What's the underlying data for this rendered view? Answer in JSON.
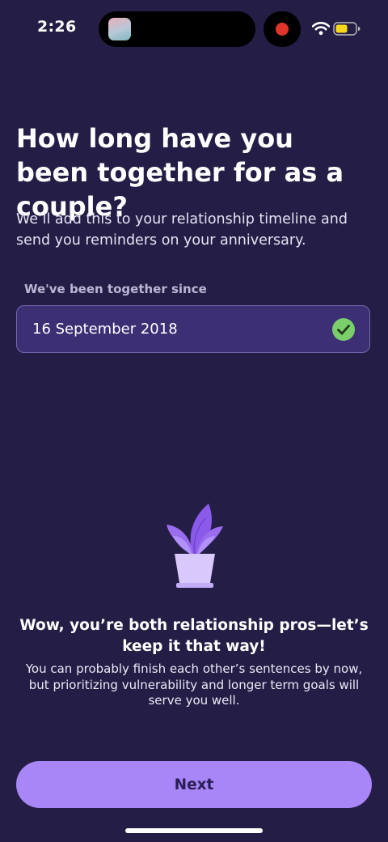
{
  "status_bar": {
    "time": "2:26",
    "icons": [
      "app-thumbnail-icon",
      "recording-dot-icon",
      "wifi-icon",
      "battery-icon"
    ],
    "colors": {
      "recording": "#e0342a",
      "battery": "#f5d81c"
    }
  },
  "question": {
    "title": "How long have you been together for as a couple?",
    "subtitle": "We’ll add this to your relationship timeline and send you reminders on your anniversary."
  },
  "date_field": {
    "label": "We've been together since",
    "value": "16 September 2018",
    "valid_icon": "check-circle-icon",
    "colors": {
      "check": "#7bcf6b"
    }
  },
  "feedback": {
    "icon": "potted-plant-icon",
    "heading": "Wow, you’re both relationship pros—let’s keep it that way!",
    "body": "You can probably finish each other’s sentences by now, but prioritizing vulnerability and longer term goals will serve you well."
  },
  "actions": {
    "next_label": "Next"
  },
  "colors": {
    "background": "#241d45",
    "accent": "#a886f7",
    "field_background": "#3d2f74",
    "plant_leaves": "#9a6cf0",
    "plant_pot": "#d9c8fb"
  }
}
